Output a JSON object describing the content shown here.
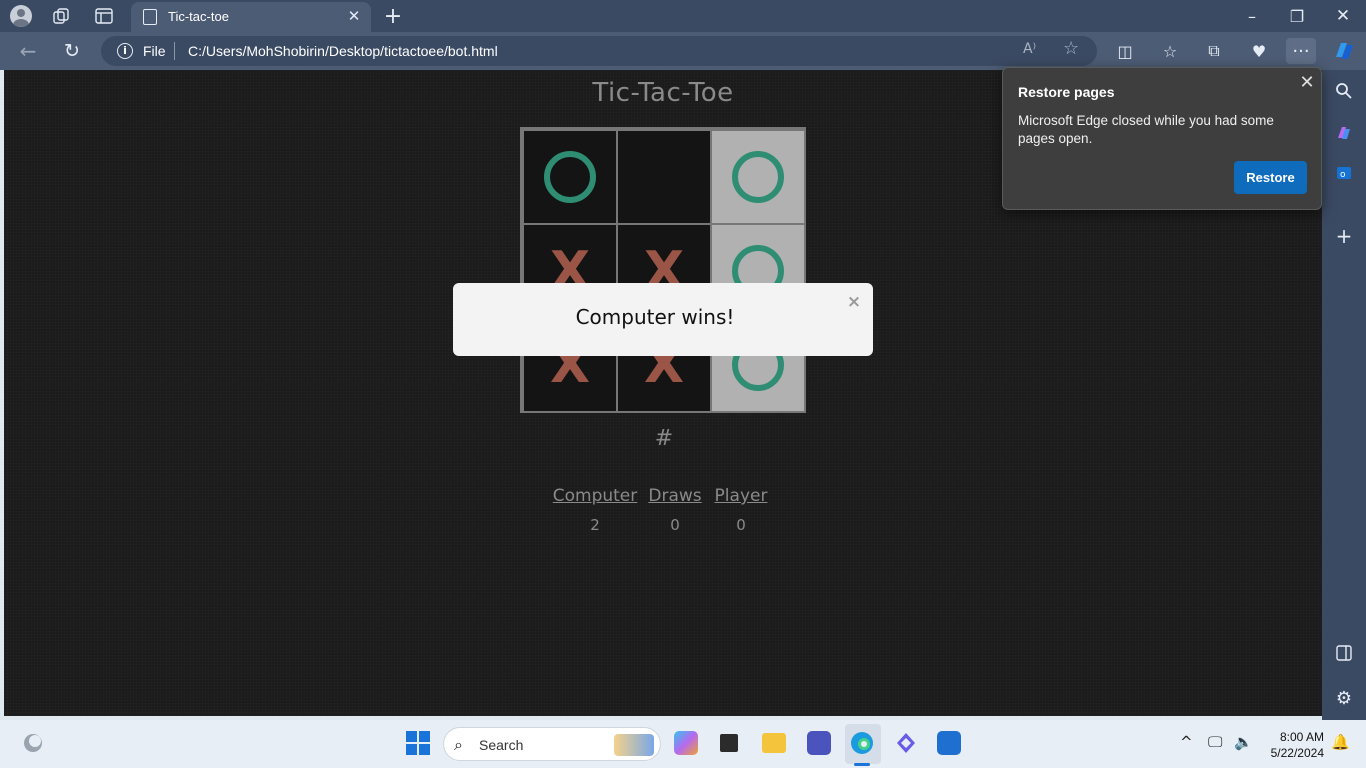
{
  "browser": {
    "tab_title": "Tic-tac-toe",
    "address_scheme": "File",
    "address_url": "C:/Users/MohShobirin/Desktop/tictactoee/bot.html",
    "icons": {
      "profile": "profile-icon",
      "workspaces": "workspaces-icon",
      "tab_actions": "tab-actions-icon",
      "new_tab": "+",
      "minimize": "–",
      "maximize": "❐",
      "close": "✕",
      "back": "←",
      "reload": "↻",
      "read_aloud": "A⁾",
      "favorite": "☆",
      "split": "◫",
      "favorites": "☆",
      "collections": "⧉",
      "performance": "♥",
      "more": "···"
    }
  },
  "game": {
    "title": "Tic-Tac-Toe",
    "board": [
      {
        "mark": "O",
        "win": false
      },
      {
        "mark": "",
        "win": false
      },
      {
        "mark": "O",
        "win": true
      },
      {
        "mark": "X",
        "win": false
      },
      {
        "mark": "X",
        "win": false
      },
      {
        "mark": "O",
        "win": true
      },
      {
        "mark": "X",
        "win": false
      },
      {
        "mark": "X",
        "win": false
      },
      {
        "mark": "O",
        "win": true
      }
    ],
    "reset_symbol": "#",
    "scores": [
      {
        "label": "Computer",
        "value": "2"
      },
      {
        "label": "Draws",
        "value": "0"
      },
      {
        "label": "Player",
        "value": "0"
      }
    ],
    "colors": {
      "o": "#2f8d73",
      "x": "#9a5546",
      "win_cell": "#b1b1b1"
    }
  },
  "modal": {
    "message": "Computer wins!",
    "close_symbol": "×"
  },
  "restore_popup": {
    "title": "Restore pages",
    "body": "Microsoft Edge closed while you had some pages open.",
    "button": "Restore",
    "close_symbol": "✕",
    "button_color": "#0f6cbd"
  },
  "taskbar": {
    "search_label": "Search",
    "time": "8:00 AM",
    "date": "5/22/2024"
  }
}
